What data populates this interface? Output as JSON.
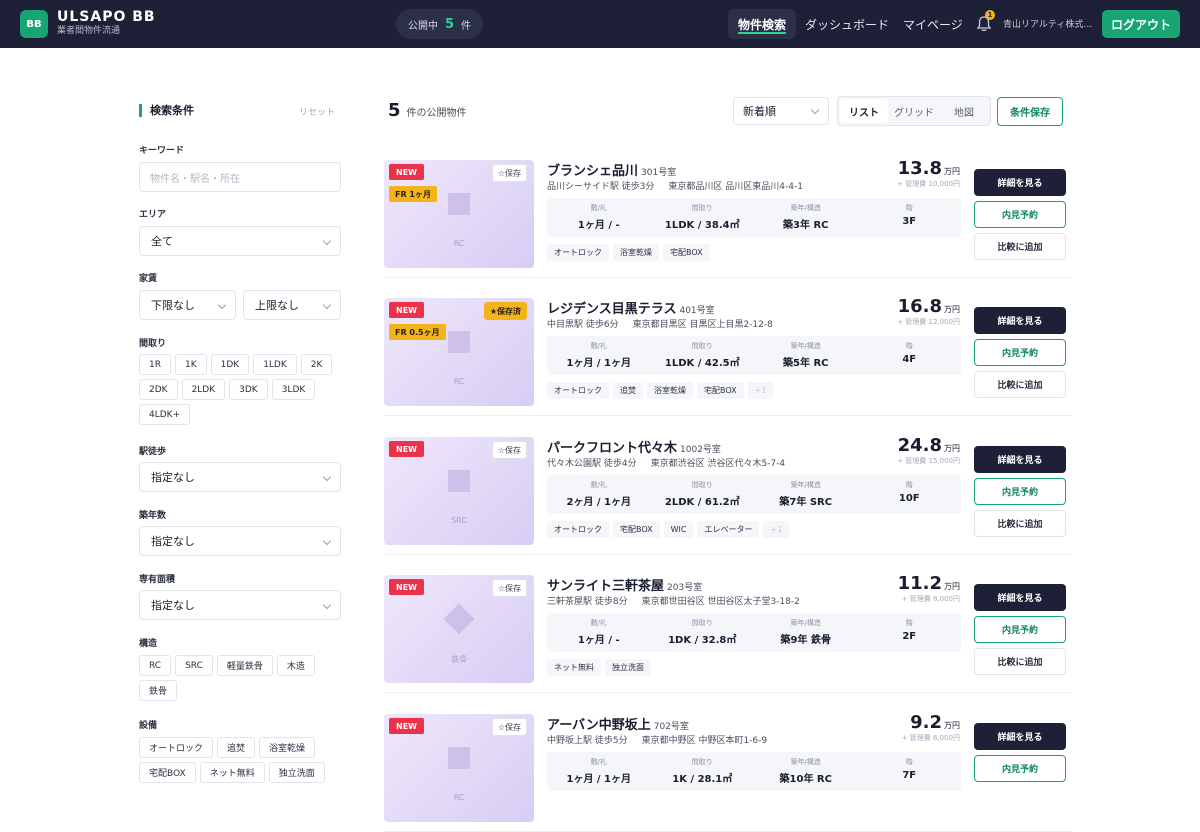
{
  "header": {
    "logo_text": "BB",
    "brand_name": "ULSAPO BB",
    "brand_sub": "業者間物件流通",
    "public_label": "公開中",
    "public_count": "5",
    "public_unit": "件",
    "nav": [
      {
        "label": "物件検索",
        "active": true
      },
      {
        "label": "ダッシュボード",
        "active": false
      },
      {
        "label": "マイページ",
        "active": false
      }
    ],
    "notification_count": "1",
    "company": "青山リアルティ株式…",
    "logout_label": "ログアウト"
  },
  "sidebar": {
    "title": "検索条件",
    "reset_label": "リセット",
    "keyword_label": "キーワード",
    "keyword_placeholder": "物件名・駅名・所在",
    "area_label": "エリア",
    "area_value": "全て",
    "rent_label": "家賃",
    "rent_min": "下限なし",
    "rent_max": "上限なし",
    "layout_label": "間取り",
    "layouts": [
      "1R",
      "1K",
      "1DK",
      "1LDK",
      "2K",
      "2DK",
      "2LDK",
      "3DK",
      "3LDK",
      "4LDK+"
    ],
    "walk_label": "駅徒歩",
    "walk_value": "指定なし",
    "age_label": "築年数",
    "age_value": "指定なし",
    "area_size_label": "専有面積",
    "area_size_value": "指定なし",
    "structure_label": "構造",
    "structures": [
      "RC",
      "SRC",
      "軽量鉄骨",
      "木造",
      "鉄骨"
    ],
    "equipment_label": "設備",
    "equipment": [
      "オートロック",
      "追焚",
      "浴室乾燥",
      "宅配BOX",
      "ネット無料",
      "独立洗面"
    ]
  },
  "main": {
    "count": "5",
    "count_text": "件の公開物件",
    "sort_value": "新着順",
    "views": [
      {
        "label": "リスト",
        "active": true
      },
      {
        "label": "グリッド",
        "active": false
      },
      {
        "label": "地図",
        "active": false
      }
    ],
    "save_condition_label": "条件保存",
    "spec_labels": {
      "deposit": "敷/礼",
      "layout": "間取り",
      "age": "築年/構造",
      "floor": "階"
    },
    "buttons": {
      "detail": "詳細を見る",
      "visit": "内見予約",
      "compare": "比較に追加"
    },
    "listings": [
      {
        "name": "ブランシェ品川",
        "room": "301号室",
        "station": "品川シーサイド駅 徒歩3分",
        "address": "東京都品川区 品川区東品川4-4-1",
        "price": "13.8",
        "price_unit": "万円",
        "mgmt": "+ 管理費 10,000円",
        "deposit": "1ヶ月 / -",
        "layout": "1LDK / 38.4㎡",
        "age": "築3年 RC",
        "floor": "3F",
        "features": [
          "オートロック",
          "浴室乾燥",
          "宅配BOX"
        ],
        "more": "",
        "tag_new": "NEW",
        "tag_fr": "FR 1ヶ月",
        "save_label": "☆保存",
        "saved": false,
        "thumb_label": "RC",
        "thumb_shape": "square"
      },
      {
        "name": "レジデンス目黒テラス",
        "room": "401号室",
        "station": "中目黒駅 徒歩6分",
        "address": "東京都目黒区 目黒区上目黒2-12-8",
        "price": "16.8",
        "price_unit": "万円",
        "mgmt": "+ 管理費 12,000円",
        "deposit": "1ヶ月 / 1ヶ月",
        "layout": "1LDK / 42.5㎡",
        "age": "築5年 RC",
        "floor": "4F",
        "features": [
          "オートロック",
          "追焚",
          "浴室乾燥",
          "宅配BOX"
        ],
        "more": "+1",
        "tag_new": "NEW",
        "tag_fr": "FR 0.5ヶ月",
        "save_label": "★保存済",
        "saved": true,
        "thumb_label": "RC",
        "thumb_shape": "square"
      },
      {
        "name": "パークフロント代々木",
        "room": "1002号室",
        "station": "代々木公園駅 徒歩4分",
        "address": "東京都渋谷区 渋谷区代々木5-7-4",
        "price": "24.8",
        "price_unit": "万円",
        "mgmt": "+ 管理費 15,000円",
        "deposit": "2ヶ月 / 1ヶ月",
        "layout": "2LDK / 61.2㎡",
        "age": "築7年 SRC",
        "floor": "10F",
        "features": [
          "オートロック",
          "宅配BOX",
          "WIC",
          "エレベーター"
        ],
        "more": "+1",
        "tag_new": "NEW",
        "tag_fr": "",
        "save_label": "☆保存",
        "saved": false,
        "thumb_label": "SRC",
        "thumb_shape": "square"
      },
      {
        "name": "サンライト三軒茶屋",
        "room": "203号室",
        "station": "三軒茶屋駅 徒歩8分",
        "address": "東京都世田谷区 世田谷区太子堂3-18-2",
        "price": "11.2",
        "price_unit": "万円",
        "mgmt": "+ 管理費 8,000円",
        "deposit": "1ヶ月 / -",
        "layout": "1DK / 32.8㎡",
        "age": "築9年 鉄骨",
        "floor": "2F",
        "features": [
          "ネット無料",
          "独立洗面"
        ],
        "more": "",
        "tag_new": "NEW",
        "tag_fr": "",
        "save_label": "☆保存",
        "saved": false,
        "thumb_label": "鉄骨",
        "thumb_shape": "diamond"
      },
      {
        "name": "アーバン中野坂上",
        "room": "702号室",
        "station": "中野坂上駅 徒歩5分",
        "address": "東京都中野区 中野区本町1-6-9",
        "price": "9.2",
        "price_unit": "万円",
        "mgmt": "+ 管理費 6,000円",
        "deposit": "1ヶ月 / 1ヶ月",
        "layout": "1K / 28.1㎡",
        "age": "築10年 RC",
        "floor": "7F",
        "features": [],
        "more": "",
        "tag_new": "NEW",
        "tag_fr": "",
        "save_label": "☆保存",
        "saved": false,
        "thumb_label": "RC",
        "thumb_shape": "square"
      }
    ]
  },
  "colors": {
    "header_bg": "#1d2036",
    "accent_green": "#17a673",
    "tag_new": "#e8334a",
    "tag_yellow": "#f2b31b"
  }
}
